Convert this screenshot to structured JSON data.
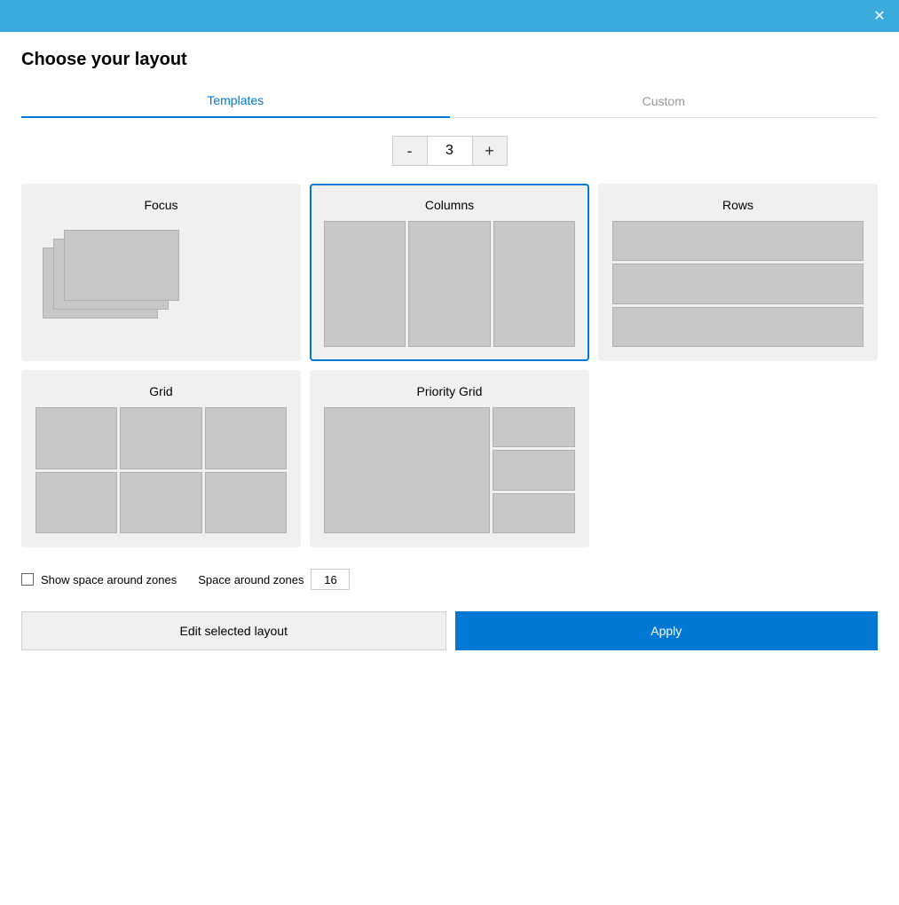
{
  "titleBar": {
    "closeLabel": "✕"
  },
  "dialog": {
    "title": "Choose your layout"
  },
  "tabs": [
    {
      "label": "Templates",
      "active": true
    },
    {
      "label": "Custom",
      "active": false
    }
  ],
  "counter": {
    "decrementLabel": "-",
    "value": "3",
    "incrementLabel": "+"
  },
  "layouts": [
    {
      "id": "focus",
      "title": "Focus",
      "selected": false,
      "type": "focus"
    },
    {
      "id": "columns",
      "title": "Columns",
      "selected": true,
      "type": "columns"
    },
    {
      "id": "rows",
      "title": "Rows",
      "selected": false,
      "type": "rows"
    },
    {
      "id": "grid",
      "title": "Grid",
      "selected": false,
      "type": "grid"
    },
    {
      "id": "priority-grid",
      "title": "Priority Grid",
      "selected": false,
      "type": "priority"
    }
  ],
  "checkboxRow": {
    "showSpaceLabel": "Show space around zones",
    "spaceAroundLabel": "Space around zones",
    "spaceValue": "16"
  },
  "buttons": {
    "editLabel": "Edit selected layout",
    "applyLabel": "Apply"
  }
}
